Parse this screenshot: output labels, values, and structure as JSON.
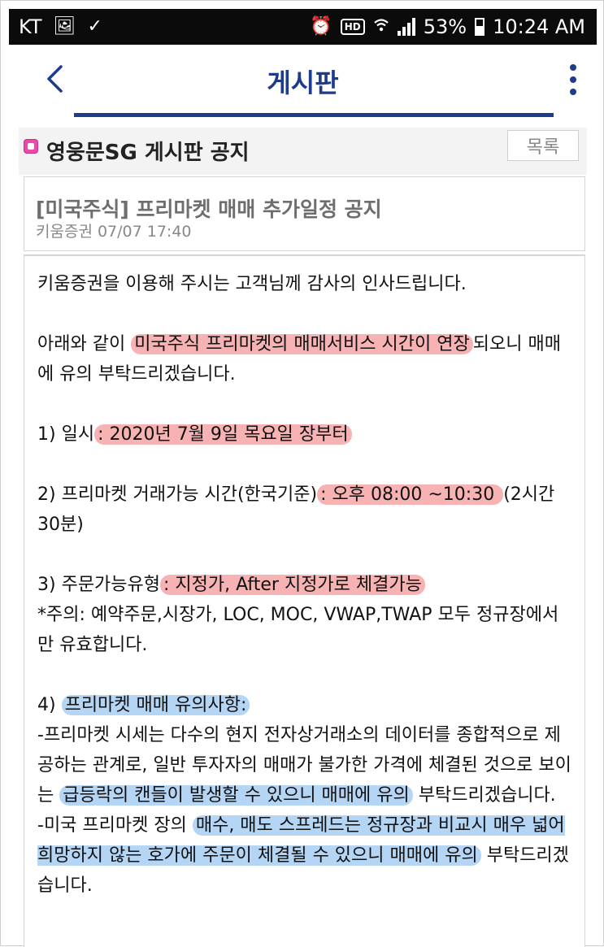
{
  "status_bar": {
    "carrier": "KT",
    "hd": "HD",
    "battery": "53%",
    "time": "10:24 AM"
  },
  "app_bar": {
    "title": "게시판"
  },
  "board": {
    "title": "영웅문SG 게시판 공지",
    "list_button": "목록"
  },
  "post": {
    "title": "[미국주식] 프리마켓 매매 추가일정 공지",
    "meta": "키움증권 07/07 17:40",
    "body": {
      "greeting": "키움증권을 이용해 주시는 고객님께 감사의 인사드립니다.",
      "p2_a": "아래와 같이 ",
      "p2_hl": "미국주식 프리마켓의 매매서비스 시간이 연장",
      "p2_b": "되오니 매매에 유의 부탁드리겠습니다.",
      "i1_label": "1) 일시",
      "i1_hl": ": 2020년 7월 9일 목요일 장부터",
      "i2_label": "2) 프리마켓 거래가능 시간(한국기준)",
      "i2_hl": ": 오후 08:00 ~10:30 ",
      "i2_tail": "(2시간 30분)",
      "i3_label": "3) 주문가능유형",
      "i3_hl": ": 지정가, After 지정가로 체결가능",
      "i3_note": "*주의: 예약주문,시장가, LOC, MOC, VWAP,TWAP 모두 정규장에서만 유효합니다.",
      "i4_label": "4) ",
      "i4_hl": "프리마켓 매매 유의사항:",
      "i4_b1_a": "-프리마켓 시세는 다수의 현지 전자상거래소의 데이터를 종합적으로 제공하는 관계로, 일반 투자자의 매매가 불가한 가격에 체결된 것으로 보이는 ",
      "i4_b1_hl": "급등락의 캔들이 발생할 수 있으니 매매에 유의",
      "i4_b1_b": " 부탁드리겠습니다.",
      "i4_b2_a": "-미국 프리마켓 장의 ",
      "i4_b2_hl": "매수, 매도 스프레드는 정규장과 비교시 매우 넓어 희망하지 않는 호가에 주문이 체결될 수 있으니 매매에 유의",
      "i4_b2_b": " 부탁드리겠습니다."
    }
  },
  "colors": {
    "accent": "#1f3b8c",
    "highlight_red": "#f7b3b3",
    "highlight_blue": "#b5d5f5"
  }
}
